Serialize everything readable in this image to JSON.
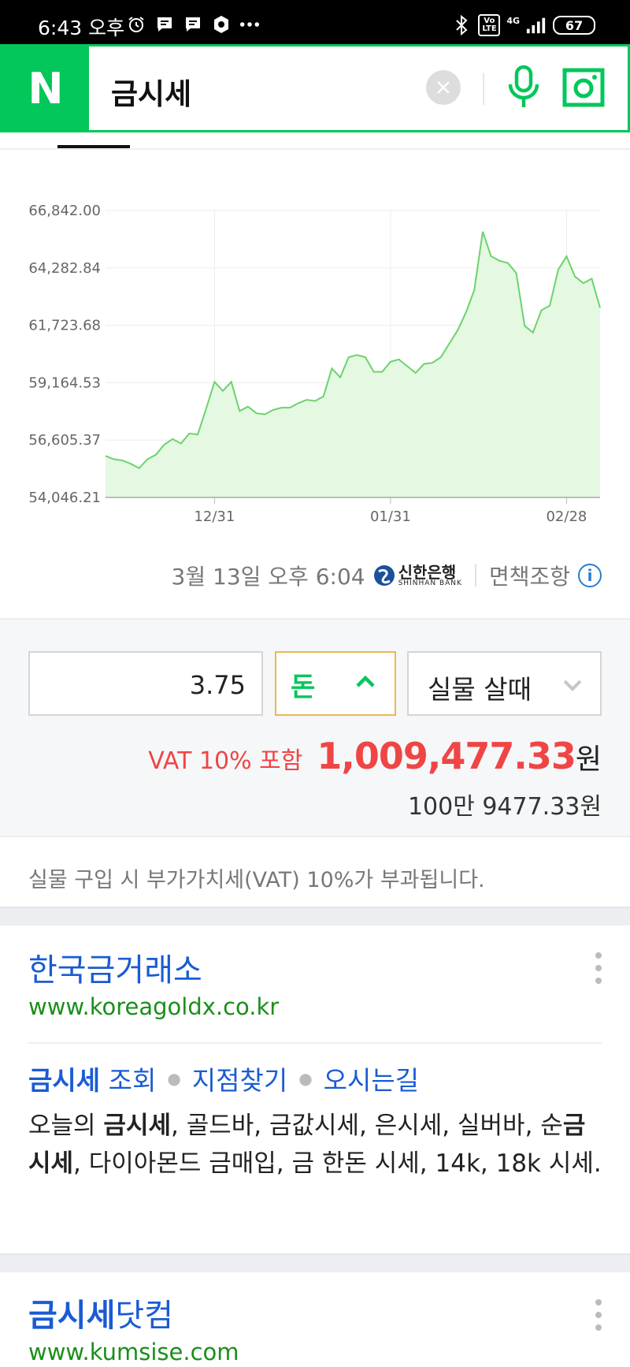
{
  "status_bar": {
    "time": "6:43 오후",
    "network": "4G",
    "volte": "Vo LTE",
    "battery": "67"
  },
  "search": {
    "logo": "N",
    "query": "금시세"
  },
  "chart_data": {
    "type": "area",
    "ylim": [
      54046.21,
      66842.0
    ],
    "y_ticks": [
      "66,842.00",
      "64,282.84",
      "61,723.68",
      "59,164.53",
      "56,605.37",
      "54,046.21"
    ],
    "x_ticks": [
      "12/31",
      "01/31",
      "02/28"
    ],
    "x_tick_index": [
      13,
      34,
      55
    ],
    "color": "#6cd36c",
    "fill": "#e4f8e2",
    "values": [
      55900,
      55750,
      55700,
      55550,
      55350,
      55750,
      55950,
      56400,
      56650,
      56450,
      56900,
      56850,
      58000,
      59200,
      58800,
      59200,
      57900,
      58100,
      57800,
      57750,
      57950,
      58050,
      58050,
      58250,
      58400,
      58350,
      58550,
      59800,
      59400,
      60300,
      60400,
      60300,
      59650,
      59650,
      60100,
      60200,
      59900,
      59600,
      60000,
      60050,
      60300,
      60900,
      61500,
      62300,
      63300,
      65900,
      64800,
      64600,
      64500,
      64050,
      61700,
      61400,
      62400,
      62600,
      64200,
      64800,
      63900,
      63600,
      63800,
      62500
    ]
  },
  "source": {
    "timestamp": "3월 13일 오후 6:04",
    "bank_name": "신한은행",
    "bank_name_en": "SHINHAN BANK",
    "disclaimer": "면책조항",
    "info_glyph": "i"
  },
  "calculator": {
    "quantity": "3.75",
    "unit": "돈",
    "mode": "실물 살때",
    "vat_label": "VAT 10% 포함",
    "amount": "1,009,477.33",
    "currency": "원",
    "amount_korean": "100만 9477.33원"
  },
  "note": "실물 구입 시 부가가치세(VAT) 10%가 부과됩니다.",
  "results": [
    {
      "title": "한국금거래소",
      "url": "www.koreagoldx.co.kr",
      "sitelinks": [
        {
          "bold": "금시세",
          "rest": " 조회"
        },
        {
          "bold": "",
          "rest": "지점찾기"
        },
        {
          "bold": "",
          "rest": "오시는길"
        }
      ],
      "desc_parts": [
        "오늘의 ",
        "금시세",
        ", 골드바, 금값시세, 은시세, 실버바, 순",
        "금시세",
        ", 다이아몬드 금매입, 금 한돈 시세, 14k, 18k 시세."
      ]
    },
    {
      "title_bold": "금시세",
      "title_rest": "닷컴",
      "url": "www.kumsise.com"
    }
  ]
}
